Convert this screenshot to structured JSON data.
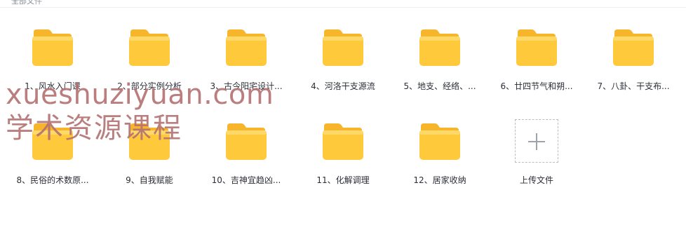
{
  "breadcrumb": "全部文件",
  "items": [
    {
      "label": "1、风水入门课",
      "type": "folder"
    },
    {
      "label": "2、部分实例分析",
      "type": "folder"
    },
    {
      "label": "3、古今阳宅设计...",
      "type": "folder"
    },
    {
      "label": "4、河洛干支源流",
      "type": "folder"
    },
    {
      "label": "5、地支、经络、...",
      "type": "folder"
    },
    {
      "label": "6、廿四节气和朔...",
      "type": "folder"
    },
    {
      "label": "7、八卦、干支布...",
      "type": "folder"
    },
    {
      "label": "8、民俗的术数原...",
      "type": "folder"
    },
    {
      "label": "9、自我赋能",
      "type": "folder"
    },
    {
      "label": "10、吉神宜趋凶...",
      "type": "folder"
    },
    {
      "label": "11、化解调理",
      "type": "folder"
    },
    {
      "label": "12、居家收纳",
      "type": "folder"
    }
  ],
  "upload": {
    "label": "上传文件"
  },
  "watermark": {
    "line1": "xueshuziyuan.com",
    "line2": "学术资源课程"
  },
  "colors": {
    "folder_body": "#FFC93C",
    "folder_tab": "#F7B52B",
    "folder_highlight": "#FFE07A"
  }
}
